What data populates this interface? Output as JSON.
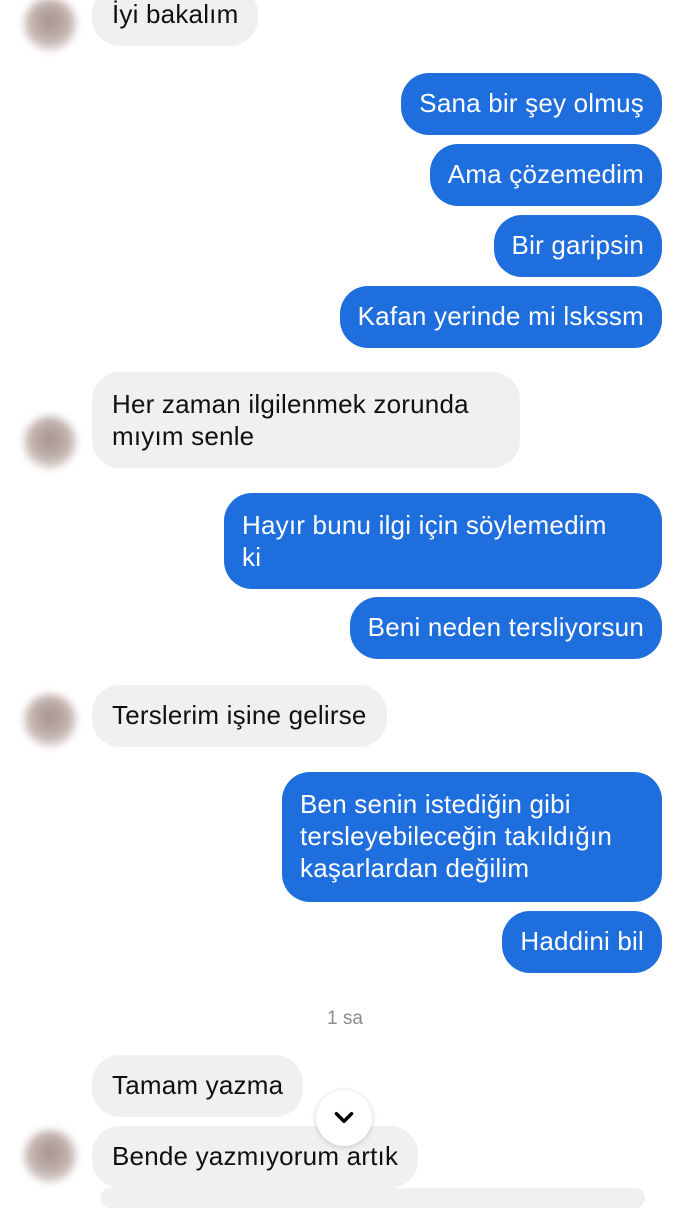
{
  "messages": {
    "m1": "İyi bakalım",
    "m2": "Sana bir şey olmuş",
    "m3": "Ama çözemedim",
    "m4": "Bir garipsin",
    "m5": "Kafan yerinde mi lskssm",
    "m6": [
      "Her zaman ilgilenmek zorunda",
      "mıyım senle"
    ],
    "m7": [
      "Hayır bunu ilgi için söylemedim",
      "ki"
    ],
    "m8": "Beni neden tersliyorsun",
    "m9": "Terslerim işine gelirse",
    "m10": [
      "Ben senin istediğin gibi",
      "tersleyebileceğin takıldığın",
      "kaşarlardan değilim"
    ],
    "m11": "Haddini bil",
    "m12": "Tamam yazma",
    "m13": "Bende yazmıyorum artık"
  },
  "timestamp": "1 sa",
  "icons": {
    "scroll_down": "chevron-down-icon",
    "avatar": "avatar"
  },
  "colors": {
    "outgoing": "#1f6ede",
    "incoming": "#f0f0f0"
  }
}
